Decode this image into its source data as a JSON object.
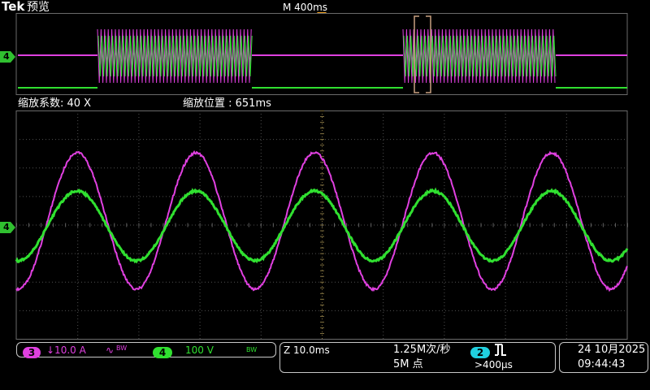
{
  "header": {
    "brand": "Tek",
    "mode": "预览",
    "timebase": "M 400ms"
  },
  "zoom_info": {
    "factor": "缩放系数: 40 X",
    "position": "缩放位置 : 651ms"
  },
  "channels": {
    "ch3": {
      "number": "3",
      "scale": "↓10.0 A",
      "coupling": "∿",
      "bw": "BW",
      "color": "#e040e0"
    },
    "ch4": {
      "number": "4",
      "scale": "100 V",
      "bw": "BW",
      "color": "#30e030"
    }
  },
  "ground_markers": {
    "overview": "4",
    "zoom": "4"
  },
  "timing": {
    "zoom_scale": "Z 10.0ms",
    "sample_rate": "1.25M次/秒",
    "record_length": "5M 点",
    "trigger_channel": "2",
    "trigger_icon": "rising-edge",
    "trigger_condition": ">400μs"
  },
  "datetime": {
    "date": "24 10月2025",
    "time": "09:44:43"
  },
  "colors": {
    "magenta": "#e040e0",
    "green": "#30e030",
    "trigger_orange": "#f0a020",
    "ch2_cyan": "#20d0e0"
  }
}
